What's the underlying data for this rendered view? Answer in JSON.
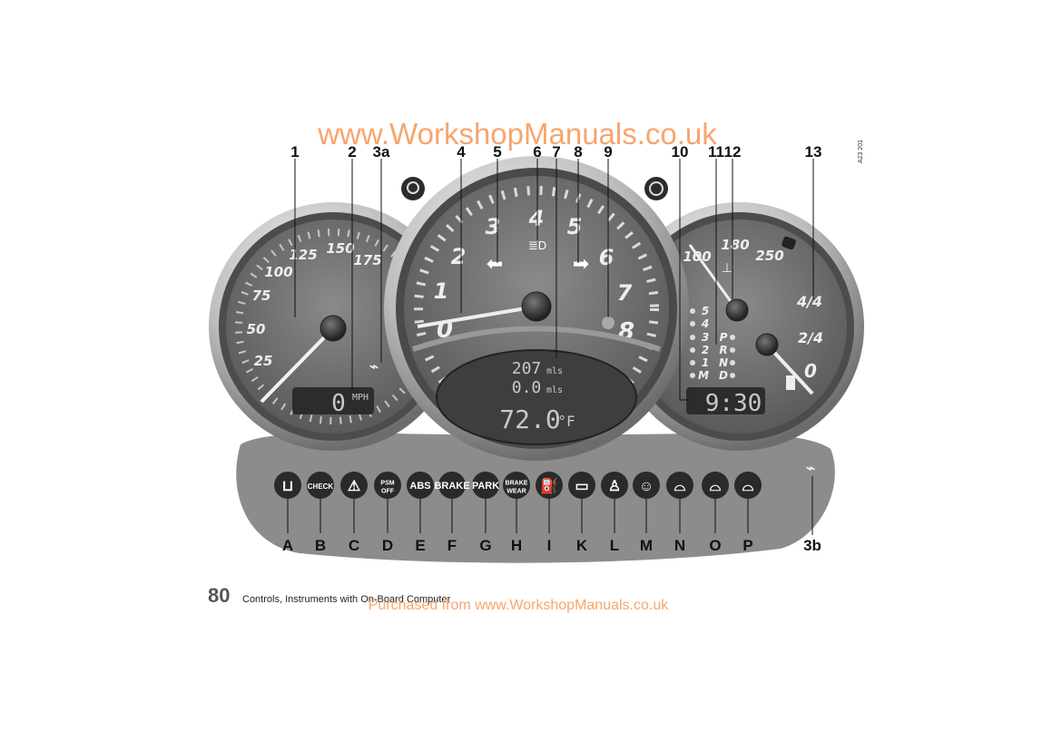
{
  "watermark_top": "www.WorkshopManuals.co.uk",
  "watermark_bottom": "Purchased from www.WorkshopManuals.co.uk",
  "figure_code": "A23 201",
  "footer": {
    "page_number": "80",
    "section_title": "Controls, Instruments with On-Board Computer"
  },
  "top_callouts": [
    "1",
    "2",
    "3a",
    "4",
    "5",
    "6",
    "7",
    "8",
    "9",
    "10",
    "11",
    "12",
    "13"
  ],
  "bottom_callouts": [
    "A",
    "B",
    "C",
    "D",
    "E",
    "F",
    "G",
    "H",
    "I",
    "K",
    "L",
    "M",
    "N",
    "O",
    "P",
    "3b"
  ],
  "speedometer": {
    "scale": [
      "25",
      "50",
      "75",
      "100",
      "125",
      "150",
      "175"
    ],
    "display_value": "0",
    "display_unit": "MPH"
  },
  "tachometer": {
    "scale": [
      "0",
      "1",
      "2",
      "3",
      "4",
      "5",
      "6",
      "7",
      "8"
    ]
  },
  "lcd": {
    "trip": "207",
    "trip_unit": "mls",
    "trip2": "0.0",
    "trip2_unit": "mls",
    "temperature": "72.0",
    "temperature_unit": "°F"
  },
  "right_gauge": {
    "temp_scale": [
      "100",
      "180",
      "250"
    ],
    "fuel_scale": [
      "0",
      "2/4",
      "4/4"
    ],
    "gears": [
      "5",
      "4",
      "3",
      "2",
      "1",
      "M"
    ],
    "selector": [
      "P",
      "R",
      "N",
      "D"
    ],
    "clock": "9:30"
  },
  "warning_lights": [
    {
      "id": "A",
      "icon": "coolant-level-icon",
      "text": ""
    },
    {
      "id": "B",
      "icon": "check-engine-icon",
      "text": "CHECK"
    },
    {
      "id": "C",
      "icon": "warning-triangle-icon",
      "text": ""
    },
    {
      "id": "D",
      "icon": "psm-off-icon",
      "text": "PSM OFF"
    },
    {
      "id": "E",
      "icon": "abs-icon",
      "text": "ABS"
    },
    {
      "id": "F",
      "icon": "brake-icon",
      "text": "BRAKE"
    },
    {
      "id": "G",
      "icon": "park-icon",
      "text": "PARK"
    },
    {
      "id": "H",
      "icon": "brake-wear-icon",
      "text": "BRAKE WEAR"
    },
    {
      "id": "I",
      "icon": "oil-pressure-icon",
      "text": ""
    },
    {
      "id": "K",
      "icon": "battery-icon",
      "text": ""
    },
    {
      "id": "L",
      "icon": "seat-belt-icon",
      "text": ""
    },
    {
      "id": "M",
      "icon": "airbag-icon",
      "text": ""
    },
    {
      "id": "N",
      "icon": "convertible-top-icon",
      "text": ""
    },
    {
      "id": "O",
      "icon": "luggage-compartment-icon",
      "text": ""
    },
    {
      "id": "P",
      "icon": "rear-lid-icon",
      "text": ""
    }
  ]
}
